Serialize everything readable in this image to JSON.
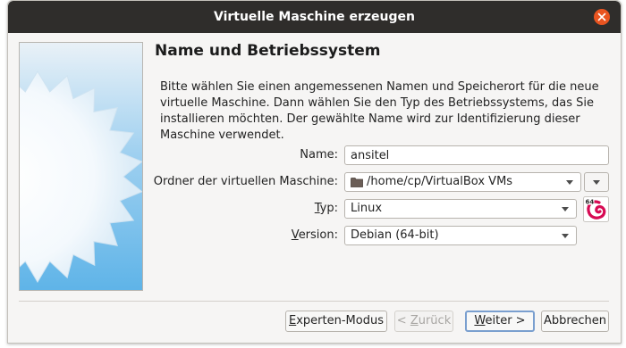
{
  "window": {
    "title": "Virtuelle Maschine erzeugen"
  },
  "page": {
    "heading": "Name und Betriebssystem",
    "description": "Bitte wählen Sie einen angemessenen Namen und Speicherort für die neue virtuelle Maschine. Dann wählen Sie den Typ des Betriebssystems, das Sie installieren möchten. Der gewählte Name wird zur Identifizierung dieser Maschine verwendet."
  },
  "form": {
    "name_label": "Name:",
    "name_value": "ansitel",
    "folder_label": "Ordner der virtuellen Maschine:",
    "folder_value": "/home/cp/VirtualBox VMs",
    "type_label_first": "T",
    "type_label_rest": "yp:",
    "type_value": "Linux",
    "version_label_first": "V",
    "version_label_rest": "ersion:",
    "version_value": "Debian (64-bit)",
    "os_icon_badge": "64"
  },
  "buttons": {
    "expert_first": "E",
    "expert_rest": "xperten-Modus",
    "back_prefix": "< ",
    "back_first": "Z",
    "back_rest": "urück",
    "next_first": "W",
    "next_rest": "eiter >",
    "cancel": "Abbrechen"
  },
  "colors": {
    "titlebar": "#2f2d2b",
    "close_button": "#e95420",
    "art_star": "#ffffff",
    "art_sky": "#5fb4e8",
    "debian_red": "#d70a53"
  }
}
